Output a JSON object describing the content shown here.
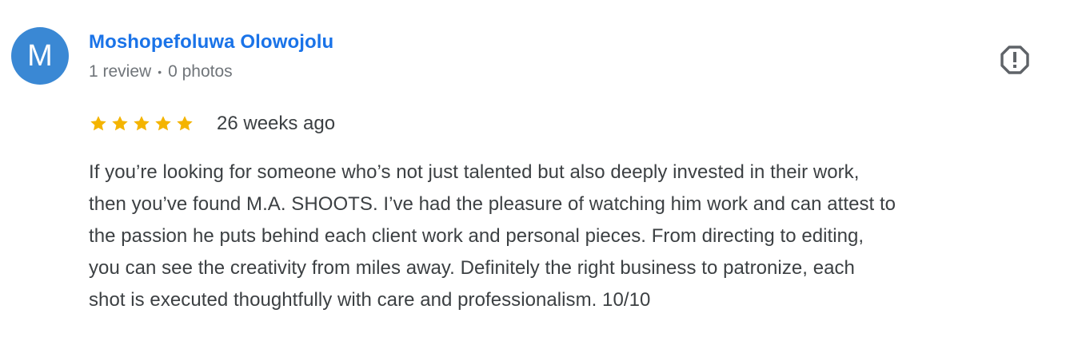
{
  "theme": {
    "avatar_bg": "#3a88d4",
    "link_color": "#1a73e8",
    "text_color": "#3c4043",
    "meta_color": "#70757a",
    "star_color": "#f4b400",
    "icon_color": "#5f6368"
  },
  "reviewer": {
    "initial": "M",
    "name": "Moshopefoluwa Olowojolu",
    "review_count": "1 review",
    "separator": "•",
    "photo_count": "0 photos"
  },
  "icons": {
    "report": "report-flag-icon",
    "star": "star-icon"
  },
  "review": {
    "rating": 5,
    "max_rating": 5,
    "time_ago": "26 weeks ago",
    "text": "If you’re looking for someone who’s not just talented but also deeply invested in their work,\nthen you’ve found M.A. SHOOTS. I’ve had the pleasure of watching him work and can attest to\nthe passion he puts behind each client work and personal pieces. From directing to editing,\nyou can see the creativity from miles away. Definitely the right business to patronize, each\nshot is executed thoughtfully with care and professionalism. 10/10"
  }
}
